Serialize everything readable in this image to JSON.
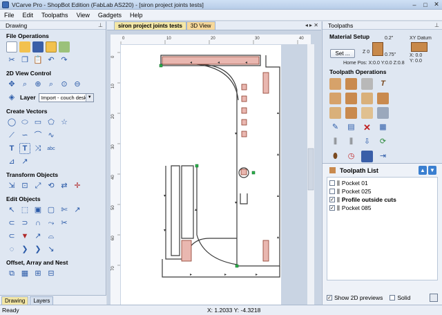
{
  "window": {
    "title": "VCarve Pro - ShopBot Edition (FabLab AS220) - [siron project joints tests]",
    "controls": [
      "–",
      "□",
      "✕"
    ]
  },
  "menu": [
    "File",
    "Edit",
    "Toolpaths",
    "View",
    "Gadgets",
    "Help"
  ],
  "left_panel": {
    "title": "Drawing",
    "sections": {
      "file_ops": "File Operations",
      "view_control": "2D View Control",
      "layer_label": "Layer",
      "layer_value": "Import - couch desk",
      "create_vectors": "Create Vectors",
      "transform": "Transform Objects",
      "edit": "Edit Objects",
      "offset": "Offset, Array and Nest"
    },
    "tabs": [
      "Drawing",
      "Layers"
    ]
  },
  "center": {
    "tabs": [
      "siron project joints tests",
      "3D View"
    ],
    "ruler_top": [
      "0",
      "10",
      "20",
      "30",
      "40"
    ],
    "ruler_left": [
      "0",
      "10",
      "20",
      "30",
      "40",
      "50",
      "60",
      "70"
    ]
  },
  "right_panel": {
    "title": "Toolpaths",
    "material_setup": "Material Setup",
    "set_button": "Set ...",
    "z_top": "0.2\"",
    "z_label": "Z 0",
    "thickness": "0.75\"",
    "home_pos": "Home Pos:  X:0.0 Y:0.0 Z:0.8",
    "xy_datum": "XY Datum",
    "datum_x": "X: 0.0",
    "datum_y": "Y: 0.0",
    "toolpath_ops": "Toolpath Operations",
    "toolpath_list_title": "Toolpath List",
    "toolpaths": [
      {
        "name": "Pocket 01",
        "checked": false,
        "bold": false
      },
      {
        "name": "Pocket 025",
        "checked": false,
        "bold": false
      },
      {
        "name": "Profile outside cuts",
        "checked": true,
        "bold": true
      },
      {
        "name": "Pocket 085",
        "checked": true,
        "bold": false
      }
    ],
    "show_previews": "Show 2D previews",
    "solid": "Solid"
  },
  "status": {
    "ready": "Ready",
    "coords": "X: 1.2033 Y: -4.3218"
  },
  "colors": {
    "accent_tab": "#f4e7a6",
    "panel_bg": "#dfe7f2",
    "vector": "#333333",
    "pocket_fill": "#e9b7b0"
  }
}
